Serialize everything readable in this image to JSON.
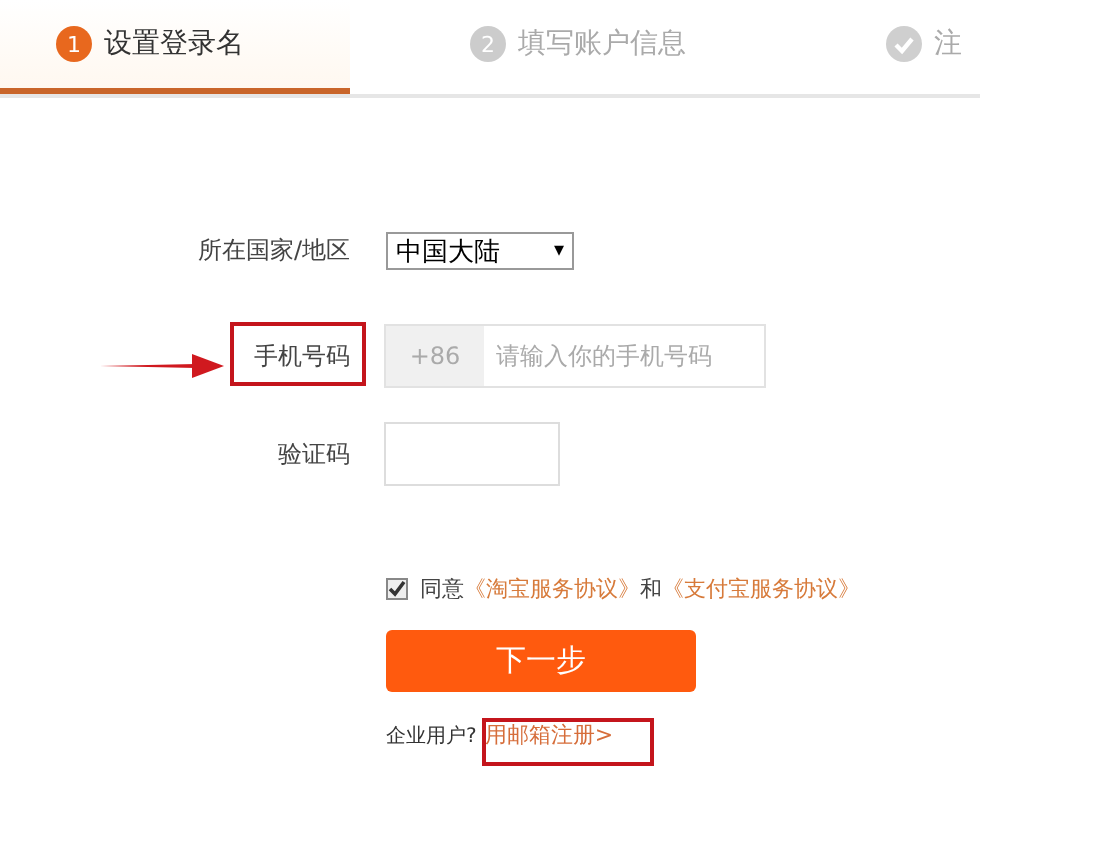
{
  "steps": [
    {
      "kind": "number",
      "number": "1",
      "label": "设置登录名",
      "selected": true
    },
    {
      "kind": "number",
      "number": "2",
      "label": "填写账户信息",
      "selected": false
    },
    {
      "kind": "check",
      "label": "注",
      "selected": false
    }
  ],
  "form": {
    "country": {
      "label": "所在国家/地区",
      "value": "中国大陆",
      "caret": "▾"
    },
    "phone": {
      "label": "手机号码",
      "prefix": "+86",
      "placeholder": "请输入你的手机号码"
    },
    "code": {
      "label": "验证码"
    },
    "agreement": {
      "checked": true,
      "text": "同意",
      "link1": "《淘宝服务协议》",
      "joiner": "和",
      "link2": "《支付宝服务协议》"
    },
    "submit": "下一步",
    "enterprise": {
      "text": "企业用户?",
      "link": "用邮箱注册>"
    }
  }
}
